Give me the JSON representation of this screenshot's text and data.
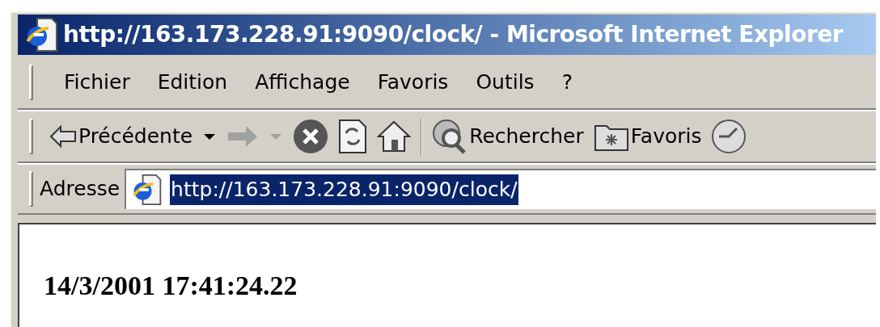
{
  "window": {
    "title": "http://163.173.228.91:9090/clock/ - Microsoft Internet Explorer"
  },
  "menu": [
    "Fichier",
    "Edition",
    "Affichage",
    "Favoris",
    "Outils",
    "?"
  ],
  "toolbar": [
    {
      "kind": "back",
      "label": "Précédente",
      "dropdown": true,
      "disabled": false
    },
    {
      "kind": "forward",
      "dropdown": true,
      "disabled": true
    },
    {
      "kind": "stop",
      "disabled": false
    },
    {
      "kind": "refresh",
      "disabled": false
    },
    {
      "kind": "home",
      "disabled": false
    },
    {
      "kind": "separator"
    },
    {
      "kind": "search",
      "label": "Rechercher",
      "disabled": false
    },
    {
      "kind": "favorites",
      "label": "Favoris",
      "disabled": false
    },
    {
      "kind": "history",
      "disabled": false
    }
  ],
  "address_bar": {
    "label": "Adresse",
    "url": "http://163.173.228.91:9090/clock/",
    "selected": true
  },
  "page": {
    "text": "14/3/2001 17:41:24.22"
  }
}
